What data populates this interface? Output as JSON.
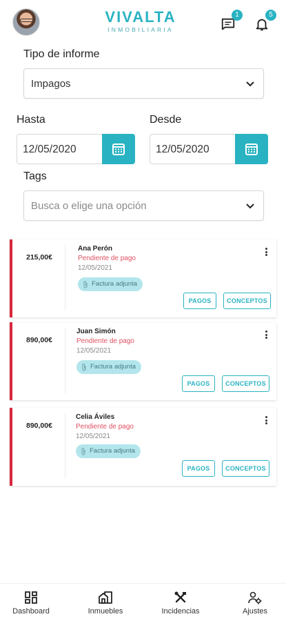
{
  "header": {
    "brand_name": "VIVALTA",
    "brand_sub": "INMOBILIARIA",
    "messages_badge": "1",
    "notifications_badge": "5",
    "brand_color": "#29b3c2"
  },
  "form": {
    "report_type_label": "Tipo de informe",
    "report_type_value": "Impagos",
    "to_label": "Hasta",
    "to_value": "12/05/2020",
    "from_label": "Desde",
    "from_value": "12/05/2020",
    "tags_label": "Tags",
    "tags_placeholder": "Busca o elige una opción"
  },
  "cards": [
    {
      "amount": "215,00€",
      "name": "Ana Perón",
      "status": "Pendiente de pago",
      "date": "12/05/2021",
      "tag": "Factura adjunta",
      "pay_label": "PAGOS",
      "concepts_label": "CONCEPTOS"
    },
    {
      "amount": "890,00€",
      "name": "Juan Simón",
      "status": "Pendiente de pago",
      "date": "12/05/2021",
      "tag": "Factura adjunta",
      "pay_label": "PAGOS",
      "concepts_label": "CONCEPTOS"
    },
    {
      "amount": "890,00€",
      "name": "Celia Áviles",
      "status": "Pendiente de pago",
      "date": "12/05/2021",
      "tag": "Factura adjunta",
      "pay_label": "PAGOS",
      "concepts_label": "CONCEPTOS"
    }
  ],
  "nav": [
    {
      "label": "Dashboard",
      "icon": "dashboard-icon"
    },
    {
      "label": "Inmuebles",
      "icon": "buildings-icon"
    },
    {
      "label": "Incidencias",
      "icon": "tools-icon"
    },
    {
      "label": "Ajustes",
      "icon": "user-settings-icon"
    }
  ],
  "colors": {
    "accent": "#29b3c2",
    "alert": "#d9263a",
    "status_text": "#e05060",
    "tag_bg": "#b3e6ec"
  }
}
